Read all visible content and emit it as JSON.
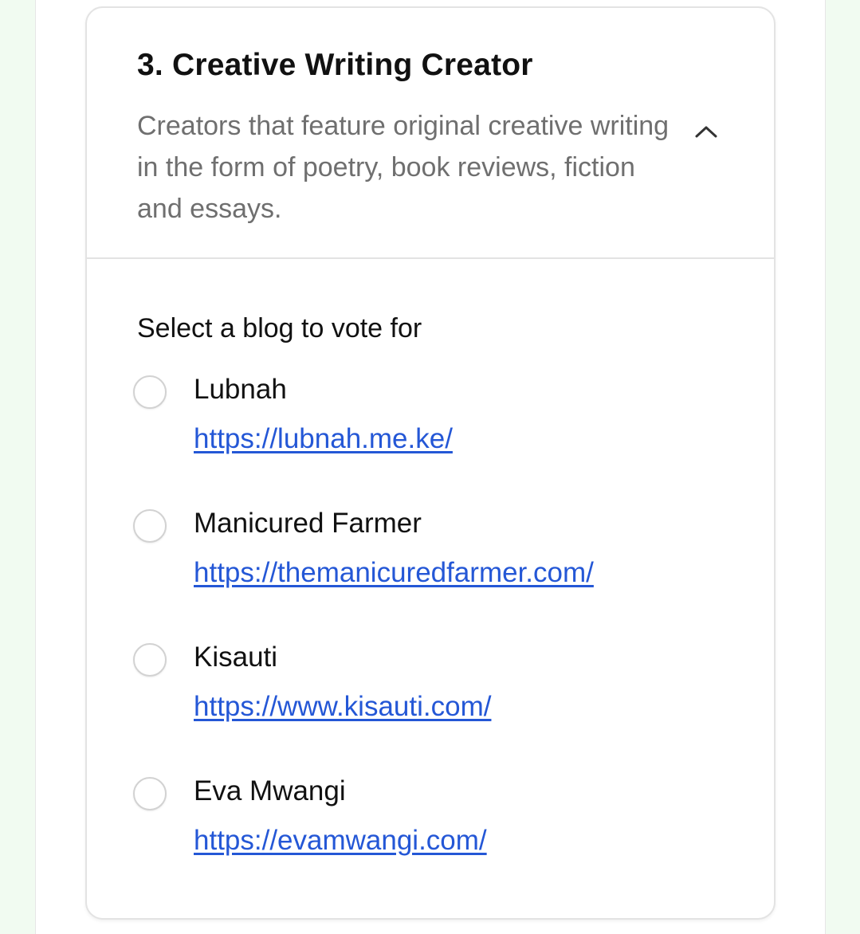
{
  "category": {
    "title": "3. Creative Writing Creator",
    "description": "Creators that feature original creative writing in the form of poetry, book reviews, fiction and essays.",
    "toggle_icon": "chevron-up-icon"
  },
  "vote": {
    "prompt": "Select a blog to vote for",
    "options": [
      {
        "name": "Lubnah",
        "url": "https://lubnah.me.ke/",
        "selected": false
      },
      {
        "name": "Manicured Farmer",
        "url": "https://themanicuredfarmer.com/",
        "selected": false
      },
      {
        "name": "Kisauti",
        "url": "https://www.kisauti.com/",
        "selected": false
      },
      {
        "name": "Eva Mwangi",
        "url": "https://evamwangi.com/",
        "selected": false
      }
    ]
  },
  "colors": {
    "link": "#2457d6",
    "muted_text": "#6f6f6f",
    "border": "#e3e3e3",
    "page_background": "#f1fbf1"
  }
}
